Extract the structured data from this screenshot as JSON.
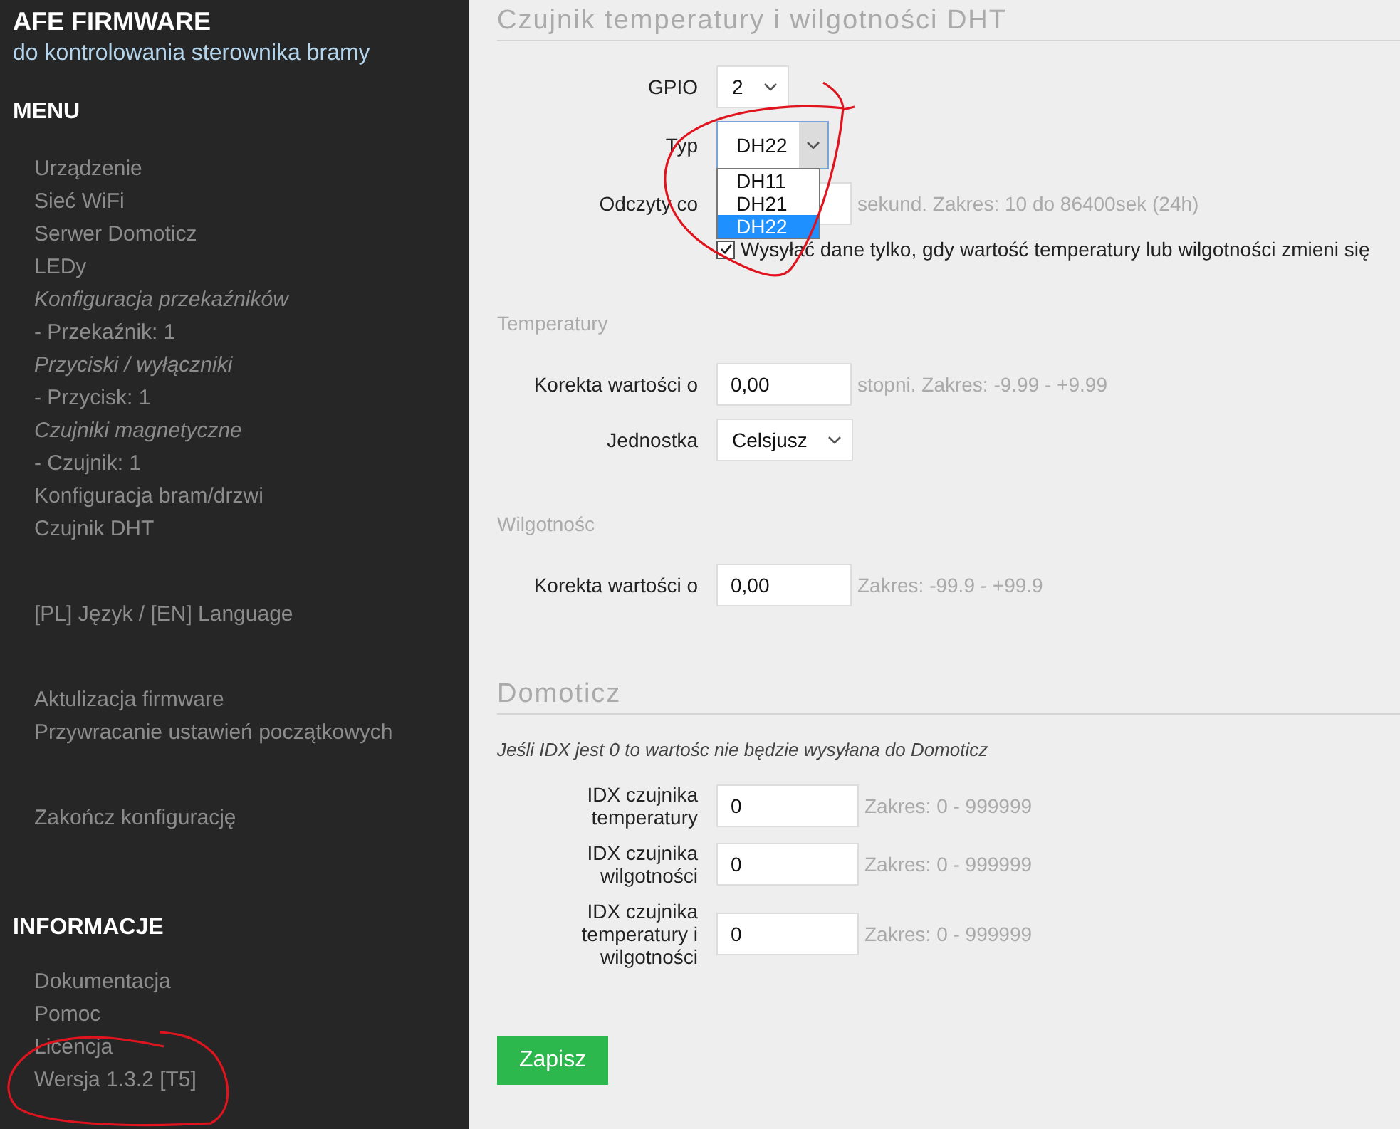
{
  "sidebar": {
    "title": "AFE FIRMWARE",
    "subtitle": "do kontrolowania sterownika bramy",
    "sections": [
      {
        "heading": "MENU",
        "groups": [
          [
            {
              "label": "Urządzenie",
              "kind": "link"
            },
            {
              "label": "Sieć WiFi",
              "kind": "link"
            },
            {
              "label": "Serwer Domoticz",
              "kind": "link"
            },
            {
              "label": "LEDy",
              "kind": "link"
            },
            {
              "label": "Konfiguracja przekaźników",
              "kind": "group"
            },
            {
              "label": "- Przekaźnik: 1",
              "kind": "link"
            },
            {
              "label": "Przyciski / wyłączniki",
              "kind": "group"
            },
            {
              "label": "- Przycisk: 1",
              "kind": "link"
            },
            {
              "label": "Czujniki magnetyczne",
              "kind": "group"
            },
            {
              "label": "- Czujnik: 1",
              "kind": "link"
            },
            {
              "label": "Konfiguracja bram/drzwi",
              "kind": "link"
            },
            {
              "label": "Czujnik DHT",
              "kind": "link"
            }
          ],
          [
            {
              "label": "[PL] Język / [EN] Language",
              "kind": "link"
            }
          ],
          [
            {
              "label": "Aktulizacja firmware",
              "kind": "link"
            },
            {
              "label": "Przywracanie ustawień początkowych",
              "kind": "link"
            }
          ],
          [
            {
              "label": "Zakończ konfigurację",
              "kind": "link"
            }
          ]
        ]
      },
      {
        "heading": "INFORMACJE",
        "groups": [
          [
            {
              "label": "Dokumentacja",
              "kind": "link"
            },
            {
              "label": "Pomoc",
              "kind": "link"
            },
            {
              "label": "Licencja",
              "kind": "link"
            },
            {
              "label": "Wersja 1.3.2 [T5]",
              "kind": "text"
            }
          ]
        ]
      }
    ]
  },
  "main": {
    "blocks": [
      {
        "kind": "title",
        "text": "Czujnik temperatury i wilgotności DHT"
      },
      {
        "kind": "select",
        "label": "GPIO",
        "value": "2",
        "open": false
      },
      {
        "kind": "select",
        "label": "Typ",
        "value": "DH22",
        "open": true,
        "options": [
          {
            "label": "DH11",
            "selected": false
          },
          {
            "label": "DH21",
            "selected": false
          },
          {
            "label": "DH22",
            "selected": true
          }
        ]
      },
      {
        "kind": "input",
        "label": "Odczyty co",
        "hint": "sekund. Zakres: 10 do 86400sek (24h)",
        "covered": true
      },
      {
        "kind": "checkbox",
        "label": "Wysyłać dane tylko, gdy wartość temperatury lub wilgotności zmieni się",
        "checked": true
      },
      {
        "kind": "subtitle",
        "text": "Temperatury"
      },
      {
        "kind": "input",
        "label": "Korekta wartości o",
        "value": "0,00",
        "hint": "stopni. Zakres: -9.99 - +9.99"
      },
      {
        "kind": "select",
        "label": "Jednostka",
        "value": "Celsjusz",
        "open": false
      },
      {
        "kind": "subtitle",
        "text": "Wilgotnośc"
      },
      {
        "kind": "input",
        "label": "Korekta wartości o",
        "value": "0,00",
        "hint": "Zakres: -99.9 - +99.9"
      },
      {
        "kind": "title",
        "text": "Domoticz"
      },
      {
        "kind": "note",
        "text": "Jeśli IDX jest 0 to wartośc nie będzie wysyłana do Domoticz"
      },
      {
        "kind": "input",
        "label": "IDX czujnika temperatury",
        "value": "0",
        "hint": "Zakres: 0 - 999999"
      },
      {
        "kind": "input",
        "label": "IDX czujnika wilgotności",
        "value": "0",
        "hint": "Zakres: 0 - 999999"
      },
      {
        "kind": "input",
        "label": "IDX czujnika temperatury i wilgotności",
        "value": "0",
        "hint": "Zakres: 0 - 999999"
      },
      {
        "kind": "button",
        "label": "Zapisz"
      }
    ]
  },
  "annotations": [
    {
      "kind": "loop"
    },
    {
      "kind": "loop"
    }
  ]
}
